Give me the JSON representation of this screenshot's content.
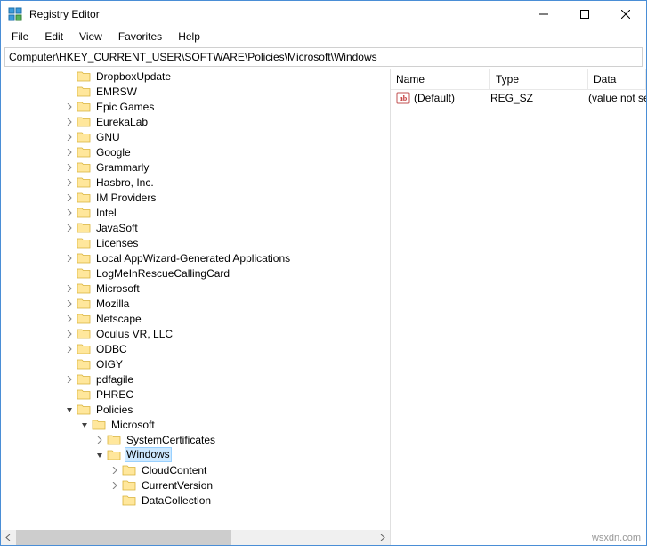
{
  "window": {
    "title": "Registry Editor"
  },
  "menu": {
    "file": "File",
    "edit": "Edit",
    "view": "View",
    "favorites": "Favorites",
    "help": "Help"
  },
  "address": "Computer\\HKEY_CURRENT_USER\\SOFTWARE\\Policies\\Microsoft\\Windows",
  "columns": {
    "name": "Name",
    "type": "Type",
    "data": "Data"
  },
  "values": [
    {
      "name": "(Default)",
      "type": "REG_SZ",
      "data": "(value not set)"
    }
  ],
  "tree": [
    {
      "indent": 4,
      "expander": "none",
      "label": "DropboxUpdate"
    },
    {
      "indent": 4,
      "expander": "none",
      "label": "EMRSW"
    },
    {
      "indent": 4,
      "expander": "collapsed",
      "label": "Epic Games"
    },
    {
      "indent": 4,
      "expander": "collapsed",
      "label": "EurekaLab"
    },
    {
      "indent": 4,
      "expander": "collapsed",
      "label": "GNU"
    },
    {
      "indent": 4,
      "expander": "collapsed",
      "label": "Google"
    },
    {
      "indent": 4,
      "expander": "collapsed",
      "label": "Grammarly"
    },
    {
      "indent": 4,
      "expander": "collapsed",
      "label": "Hasbro, Inc."
    },
    {
      "indent": 4,
      "expander": "collapsed",
      "label": "IM Providers"
    },
    {
      "indent": 4,
      "expander": "collapsed",
      "label": "Intel"
    },
    {
      "indent": 4,
      "expander": "collapsed",
      "label": "JavaSoft"
    },
    {
      "indent": 4,
      "expander": "none",
      "label": "Licenses"
    },
    {
      "indent": 4,
      "expander": "collapsed",
      "label": "Local AppWizard-Generated Applications"
    },
    {
      "indent": 4,
      "expander": "none",
      "label": "LogMeInRescueCallingCard"
    },
    {
      "indent": 4,
      "expander": "collapsed",
      "label": "Microsoft"
    },
    {
      "indent": 4,
      "expander": "collapsed",
      "label": "Mozilla"
    },
    {
      "indent": 4,
      "expander": "collapsed",
      "label": "Netscape"
    },
    {
      "indent": 4,
      "expander": "collapsed",
      "label": "Oculus VR, LLC"
    },
    {
      "indent": 4,
      "expander": "collapsed",
      "label": "ODBC"
    },
    {
      "indent": 4,
      "expander": "none",
      "label": "OIGY"
    },
    {
      "indent": 4,
      "expander": "collapsed",
      "label": "pdfagile"
    },
    {
      "indent": 4,
      "expander": "none",
      "label": "PHREC"
    },
    {
      "indent": 4,
      "expander": "expanded",
      "label": "Policies"
    },
    {
      "indent": 5,
      "expander": "expanded",
      "label": "Microsoft"
    },
    {
      "indent": 6,
      "expander": "collapsed",
      "label": "SystemCertificates"
    },
    {
      "indent": 6,
      "expander": "expanded",
      "label": "Windows",
      "selected": true
    },
    {
      "indent": 7,
      "expander": "collapsed",
      "label": "CloudContent"
    },
    {
      "indent": 7,
      "expander": "collapsed",
      "label": "CurrentVersion"
    },
    {
      "indent": 7,
      "expander": "none",
      "label": "DataCollection"
    }
  ],
  "watermark": "wsxdn.com"
}
